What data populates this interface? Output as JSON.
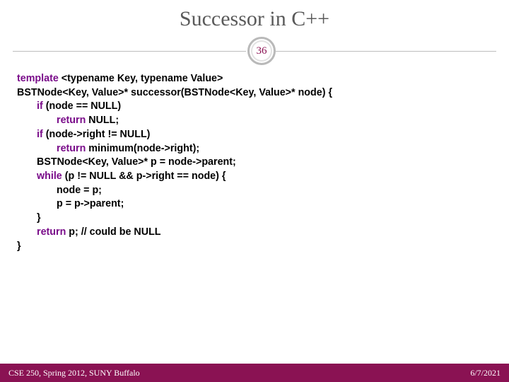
{
  "title": "Successor in C++",
  "slide_number": "36",
  "code": {
    "l1a": "template ",
    "l1b": "<typename Key, typename Value>",
    "l2": "BSTNode<Key, Value>* successor(BSTNode<Key, Value>* node) {",
    "l3a": "if ",
    "l3b": "(node == NULL)",
    "l4a": "return ",
    "l4b": "NULL;",
    "l5a": "if ",
    "l5b": "(node->right != NULL)",
    "l6a": "return ",
    "l6b": "minimum(node->right);",
    "l7": "BSTNode<Key, Value>* p = node->parent;",
    "l8a": "while ",
    "l8b": "(p != NULL && p->right == node) {",
    "l9": "node = p;",
    "l10": "p = p->parent;",
    "l11": "}",
    "l12a": "return ",
    "l12b": "p; // could be NULL",
    "l13": "}"
  },
  "footer": {
    "left": "CSE 250, Spring 2012, SUNY Buffalo",
    "right": "6/7/2021"
  }
}
